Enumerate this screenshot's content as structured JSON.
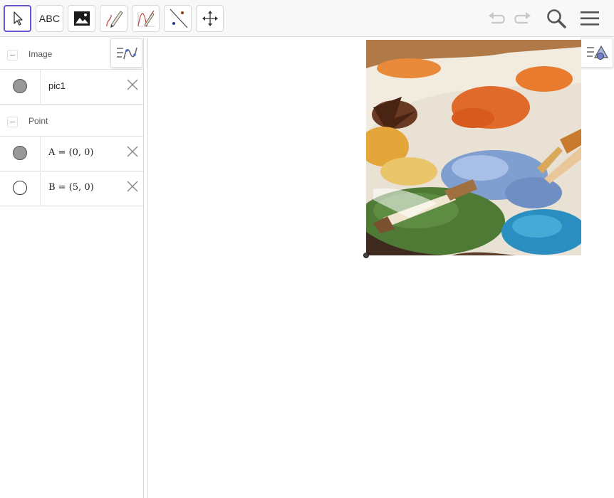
{
  "toolbar": {
    "tools": [
      {
        "name": "move",
        "icon": "cursor-arrow-icon"
      },
      {
        "name": "text",
        "label": "ABC"
      },
      {
        "name": "image",
        "icon": "image-icon"
      },
      {
        "name": "pen",
        "icon": "pen-icon"
      },
      {
        "name": "function-inspector",
        "icon": "function-pen-icon"
      },
      {
        "name": "line",
        "icon": "line-through-points-icon"
      },
      {
        "name": "move-graphics",
        "icon": "move-arrows-icon"
      }
    ],
    "undo_icon": "undo-icon",
    "redo_icon": "redo-icon",
    "search_icon": "search-icon",
    "menu_icon": "hamburger-menu-icon"
  },
  "algebra": {
    "groups": [
      {
        "label": "Image",
        "items": [
          {
            "text": "pic1",
            "visible": true
          }
        ]
      },
      {
        "label": "Point",
        "items": [
          {
            "text": "A = (0, 0)",
            "visible": true
          },
          {
            "text": "B = (5, 0)",
            "visible": false
          }
        ]
      }
    ]
  },
  "colors": {
    "active_tool_border": "#6557d2",
    "toolbar_bg": "#f8f8f8"
  }
}
